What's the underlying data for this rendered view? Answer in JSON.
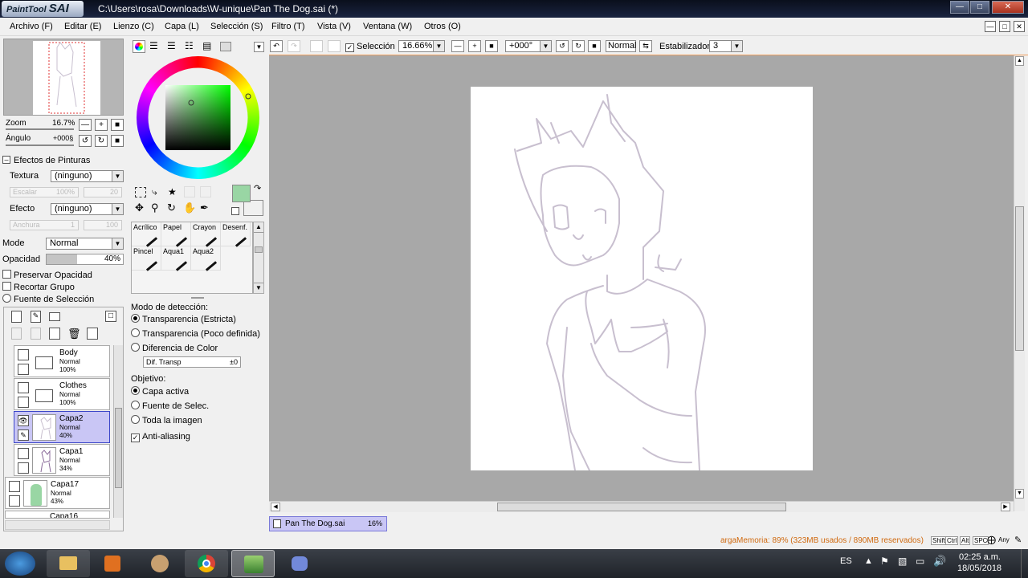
{
  "window": {
    "app_logo_small": "PaintTool",
    "app_logo_big": "SAI",
    "title": "C:\\Users\\rosa\\Downloads\\W-unique\\Pan The Dog.sai (*)"
  },
  "menu": {
    "items": [
      "Archivo (F)",
      "Editar (E)",
      "Lienzo (C)",
      "Capa (L)",
      "Selección (S)",
      "Filtro (T)",
      "Vista (V)",
      "Ventana (W)",
      "Otros (O)"
    ]
  },
  "navigator": {
    "zoom_label": "Zoom",
    "zoom_value": "16.7%",
    "angle_label": "Ángulo",
    "angle_value": "+000§"
  },
  "paint_effects": {
    "header": "Efectos de Pinturas",
    "texture_label": "Textura",
    "texture_value": "(ninguno)",
    "scale_label": "Escalar",
    "scale_value": "100%",
    "scale_value2": "20",
    "effect_label": "Efecto",
    "effect_value": "(ninguno)",
    "width_label": "Anchura",
    "width_value": "1",
    "width_value2": "100"
  },
  "layer_props": {
    "mode_label": "Mode",
    "mode_value": "Normal",
    "opacity_label": "Opacidad",
    "opacity_value": "40%",
    "opacity_fraction": 0.4,
    "preserve_opacity": "Preservar Opacidad",
    "clip_group": "Recortar Grupo",
    "selection_source": "Fuente de Selección"
  },
  "layers": [
    {
      "name": "Body",
      "mode": "Normal",
      "opacity": "100%",
      "type": "folder",
      "selected": false
    },
    {
      "name": "Clothes",
      "mode": "Normal",
      "opacity": "100%",
      "type": "folder",
      "selected": false
    },
    {
      "name": "Capa2",
      "mode": "Normal",
      "opacity": "40%",
      "type": "layer",
      "selected": true
    },
    {
      "name": "Capa1",
      "mode": "Normal",
      "opacity": "34%",
      "type": "layer",
      "selected": false
    },
    {
      "name": "Capa17",
      "mode": "Normal",
      "opacity": "43%",
      "type": "layer",
      "selected": false
    },
    {
      "name": "Capa16",
      "mode": "",
      "opacity": "",
      "type": "layer",
      "selected": false
    }
  ],
  "brushes": [
    {
      "name": "Acrílico"
    },
    {
      "name": "Papel"
    },
    {
      "name": "Crayon"
    },
    {
      "name": "Desenf."
    },
    {
      "name": "Pincel"
    },
    {
      "name": "Aqua1"
    },
    {
      "name": "Aqua2"
    }
  ],
  "colors": {
    "foreground": "#99d6a4",
    "background": "#ffffff",
    "selected_layer": "#c9c6f5",
    "sketch_stroke": "#c8bfcf"
  },
  "detection": {
    "header": "Modo de detección:",
    "options": [
      "Transparencia (Estricta)",
      "Transparencia (Poco definida)",
      "Diferencia de Color"
    ],
    "selected_index": 0,
    "field_label": "Dif. Transp",
    "field_value": "±0",
    "target_header": "Objetivo:",
    "targets": [
      "Capa activa",
      "Fuente de Selec.",
      "Toda la imagen"
    ],
    "target_selected": 0,
    "antialias": "Anti-aliasing"
  },
  "canvas_toolbar": {
    "selection_label": "Selección",
    "zoom": "16.66%",
    "angle": "+000°",
    "mode": "Normal",
    "stabilizer_label": "Estabilizador",
    "stabilizer_value": "3"
  },
  "document_tab": {
    "name": "Pan The Dog.sai",
    "zoom": "16%"
  },
  "status": {
    "memory": "argaMemoria: 89% (323MB usados / 890MB reservados)",
    "keys": [
      "Shift",
      "Ctrl",
      "Alt",
      "SPC",
      "Any"
    ]
  },
  "taskbar": {
    "lang": "ES",
    "time": "02:25 a.m.",
    "date": "18/05/2018"
  }
}
